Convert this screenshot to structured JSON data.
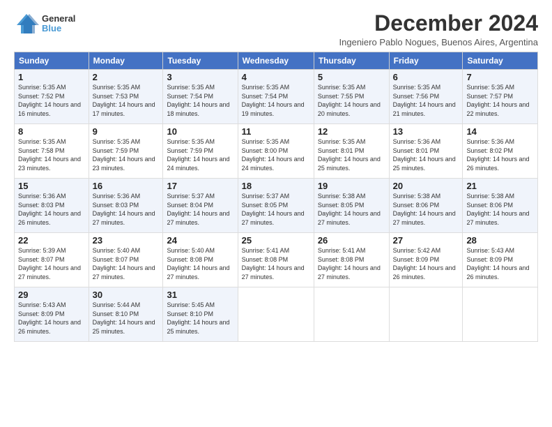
{
  "logo": {
    "line1": "General",
    "line2": "Blue"
  },
  "title": "December 2024",
  "subtitle": "Ingeniero Pablo Nogues, Buenos Aires, Argentina",
  "weekdays": [
    "Sunday",
    "Monday",
    "Tuesday",
    "Wednesday",
    "Thursday",
    "Friday",
    "Saturday"
  ],
  "weeks": [
    [
      {
        "day": "1",
        "sunrise": "Sunrise: 5:35 AM",
        "sunset": "Sunset: 7:52 PM",
        "daylight": "Daylight: 14 hours and 16 minutes."
      },
      {
        "day": "2",
        "sunrise": "Sunrise: 5:35 AM",
        "sunset": "Sunset: 7:53 PM",
        "daylight": "Daylight: 14 hours and 17 minutes."
      },
      {
        "day": "3",
        "sunrise": "Sunrise: 5:35 AM",
        "sunset": "Sunset: 7:54 PM",
        "daylight": "Daylight: 14 hours and 18 minutes."
      },
      {
        "day": "4",
        "sunrise": "Sunrise: 5:35 AM",
        "sunset": "Sunset: 7:54 PM",
        "daylight": "Daylight: 14 hours and 19 minutes."
      },
      {
        "day": "5",
        "sunrise": "Sunrise: 5:35 AM",
        "sunset": "Sunset: 7:55 PM",
        "daylight": "Daylight: 14 hours and 20 minutes."
      },
      {
        "day": "6",
        "sunrise": "Sunrise: 5:35 AM",
        "sunset": "Sunset: 7:56 PM",
        "daylight": "Daylight: 14 hours and 21 minutes."
      },
      {
        "day": "7",
        "sunrise": "Sunrise: 5:35 AM",
        "sunset": "Sunset: 7:57 PM",
        "daylight": "Daylight: 14 hours and 22 minutes."
      }
    ],
    [
      {
        "day": "8",
        "sunrise": "Sunrise: 5:35 AM",
        "sunset": "Sunset: 7:58 PM",
        "daylight": "Daylight: 14 hours and 23 minutes."
      },
      {
        "day": "9",
        "sunrise": "Sunrise: 5:35 AM",
        "sunset": "Sunset: 7:59 PM",
        "daylight": "Daylight: 14 hours and 23 minutes."
      },
      {
        "day": "10",
        "sunrise": "Sunrise: 5:35 AM",
        "sunset": "Sunset: 7:59 PM",
        "daylight": "Daylight: 14 hours and 24 minutes."
      },
      {
        "day": "11",
        "sunrise": "Sunrise: 5:35 AM",
        "sunset": "Sunset: 8:00 PM",
        "daylight": "Daylight: 14 hours and 24 minutes."
      },
      {
        "day": "12",
        "sunrise": "Sunrise: 5:35 AM",
        "sunset": "Sunset: 8:01 PM",
        "daylight": "Daylight: 14 hours and 25 minutes."
      },
      {
        "day": "13",
        "sunrise": "Sunrise: 5:36 AM",
        "sunset": "Sunset: 8:01 PM",
        "daylight": "Daylight: 14 hours and 25 minutes."
      },
      {
        "day": "14",
        "sunrise": "Sunrise: 5:36 AM",
        "sunset": "Sunset: 8:02 PM",
        "daylight": "Daylight: 14 hours and 26 minutes."
      }
    ],
    [
      {
        "day": "15",
        "sunrise": "Sunrise: 5:36 AM",
        "sunset": "Sunset: 8:03 PM",
        "daylight": "Daylight: 14 hours and 26 minutes."
      },
      {
        "day": "16",
        "sunrise": "Sunrise: 5:36 AM",
        "sunset": "Sunset: 8:03 PM",
        "daylight": "Daylight: 14 hours and 27 minutes."
      },
      {
        "day": "17",
        "sunrise": "Sunrise: 5:37 AM",
        "sunset": "Sunset: 8:04 PM",
        "daylight": "Daylight: 14 hours and 27 minutes."
      },
      {
        "day": "18",
        "sunrise": "Sunrise: 5:37 AM",
        "sunset": "Sunset: 8:05 PM",
        "daylight": "Daylight: 14 hours and 27 minutes."
      },
      {
        "day": "19",
        "sunrise": "Sunrise: 5:38 AM",
        "sunset": "Sunset: 8:05 PM",
        "daylight": "Daylight: 14 hours and 27 minutes."
      },
      {
        "day": "20",
        "sunrise": "Sunrise: 5:38 AM",
        "sunset": "Sunset: 8:06 PM",
        "daylight": "Daylight: 14 hours and 27 minutes."
      },
      {
        "day": "21",
        "sunrise": "Sunrise: 5:38 AM",
        "sunset": "Sunset: 8:06 PM",
        "daylight": "Daylight: 14 hours and 27 minutes."
      }
    ],
    [
      {
        "day": "22",
        "sunrise": "Sunrise: 5:39 AM",
        "sunset": "Sunset: 8:07 PM",
        "daylight": "Daylight: 14 hours and 27 minutes."
      },
      {
        "day": "23",
        "sunrise": "Sunrise: 5:40 AM",
        "sunset": "Sunset: 8:07 PM",
        "daylight": "Daylight: 14 hours and 27 minutes."
      },
      {
        "day": "24",
        "sunrise": "Sunrise: 5:40 AM",
        "sunset": "Sunset: 8:08 PM",
        "daylight": "Daylight: 14 hours and 27 minutes."
      },
      {
        "day": "25",
        "sunrise": "Sunrise: 5:41 AM",
        "sunset": "Sunset: 8:08 PM",
        "daylight": "Daylight: 14 hours and 27 minutes."
      },
      {
        "day": "26",
        "sunrise": "Sunrise: 5:41 AM",
        "sunset": "Sunset: 8:08 PM",
        "daylight": "Daylight: 14 hours and 27 minutes."
      },
      {
        "day": "27",
        "sunrise": "Sunrise: 5:42 AM",
        "sunset": "Sunset: 8:09 PM",
        "daylight": "Daylight: 14 hours and 26 minutes."
      },
      {
        "day": "28",
        "sunrise": "Sunrise: 5:43 AM",
        "sunset": "Sunset: 8:09 PM",
        "daylight": "Daylight: 14 hours and 26 minutes."
      }
    ],
    [
      {
        "day": "29",
        "sunrise": "Sunrise: 5:43 AM",
        "sunset": "Sunset: 8:09 PM",
        "daylight": "Daylight: 14 hours and 26 minutes."
      },
      {
        "day": "30",
        "sunrise": "Sunrise: 5:44 AM",
        "sunset": "Sunset: 8:10 PM",
        "daylight": "Daylight: 14 hours and 25 minutes."
      },
      {
        "day": "31",
        "sunrise": "Sunrise: 5:45 AM",
        "sunset": "Sunset: 8:10 PM",
        "daylight": "Daylight: 14 hours and 25 minutes."
      },
      null,
      null,
      null,
      null
    ]
  ]
}
